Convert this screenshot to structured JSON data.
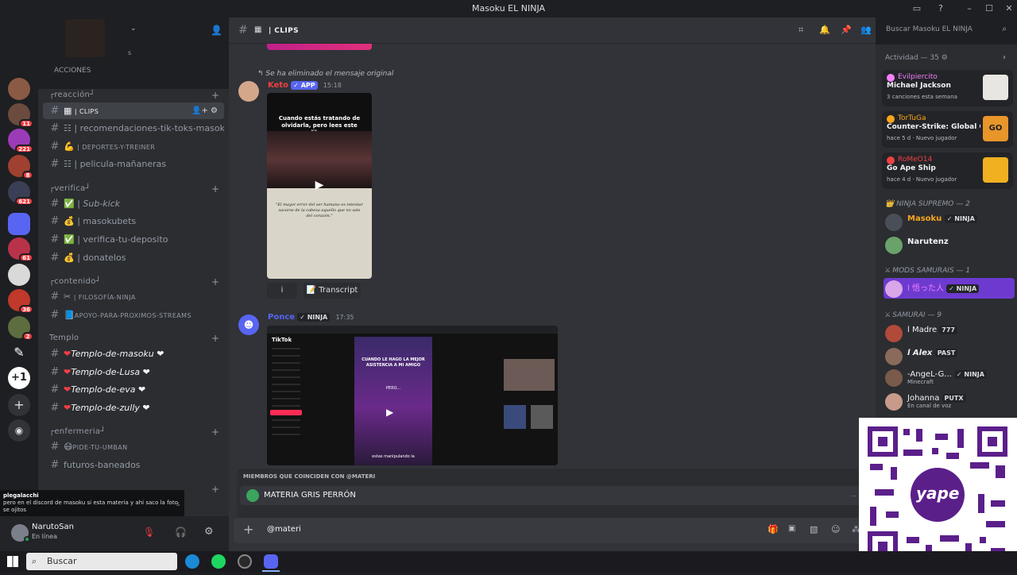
{
  "window": {
    "title": "Masoku EL NINJA",
    "minimize": "–",
    "maximize": "☐",
    "close": "✕"
  },
  "server": {
    "partial_name": "s",
    "partial_channel": "ACCIONES"
  },
  "guild_badges": [
    "11",
    "221",
    "8",
    "621",
    "61",
    "36",
    "2"
  ],
  "categories": [
    {
      "label": "┌reacción┘",
      "channels": [
        {
          "icon": "▦",
          "label": "| CLIPS",
          "active": true,
          "smallcaps": true
        },
        {
          "icon": "☷",
          "label": "| recomendaciones-tik-toks-masoku"
        },
        {
          "icon": "💪",
          "label": "| DEPORTES-Y-TREINER",
          "smallcaps": true
        },
        {
          "icon": "☷",
          "label": "| pelicula-mañaneras"
        }
      ]
    },
    {
      "label": "┌verifica┘",
      "channels": [
        {
          "icon": "✅",
          "label": "| Sub-kick",
          "italic": true
        },
        {
          "icon": "💰",
          "label": "| masokubets"
        },
        {
          "icon": "✅",
          "label": "| verifica-tu-deposito"
        },
        {
          "icon": "💰",
          "label": "| donatelos"
        }
      ]
    },
    {
      "label": "┌contenido┘",
      "channels": [
        {
          "icon": "✂",
          "label": "| FILOSOFÍA-NINJA",
          "smallcaps": true
        },
        {
          "icon": "📘",
          "label": "APOYO-PARA-PROXIMOS-STREAMS",
          "smallcaps": true
        }
      ]
    },
    {
      "label": "Templo",
      "channels": [
        {
          "icon": "❤",
          "label": "Templo-de-masoku ❤",
          "italic": true
        },
        {
          "icon": "❤",
          "label": "Templo-de-Lusa ❤",
          "italic": true
        },
        {
          "icon": "❤",
          "label": "Templo-de-eva ❤",
          "italic": true
        },
        {
          "icon": "❤",
          "label": "Templo-de-zully ❤",
          "italic": true
        }
      ]
    },
    {
      "label": "┌enfermeria┘",
      "channels": [
        {
          "icon": "😷",
          "label": "PIDE-TU-UMBAN",
          "smallcaps": true
        },
        {
          "icon": "",
          "label": "futuros-baneados"
        }
      ]
    }
  ],
  "notification": {
    "user": "plegalacchi",
    "text": "pero en el discord de masoku si esta materia y ahi saco la foto se ojitos",
    "tail": "s"
  },
  "user": {
    "name": "NarutoSan",
    "status": "En línea"
  },
  "channel_header": {
    "name": "| CLIPS",
    "search_placeholder": "Buscar Masoku EL NINJA"
  },
  "messages": [
    {
      "deleted_note": "Se ha eliminado el mensaje original",
      "author": "Keto",
      "tag": "✓ APP",
      "time": "15:18",
      "video_caption": "Cuando estás tratando de olvidarla, pero lees este libro:",
      "book_quote": "\"El mayor error del ser humano es intentar sacarse de la cabeza aquello que no sale del corazón.\"",
      "button_info": "i",
      "button_transcript": "Transcript"
    },
    {
      "author": "Ponce",
      "tag": "✓ NINJA",
      "time": "17:35",
      "tiktok_logo": "TikTok",
      "tiktok_caption": "CUANDO LE HAGO LA MEJOR ASISTENCIA A MI AMIGO",
      "tiktok_small": "PERO...",
      "tiktok_bottom": "estas manipulando la"
    }
  ],
  "mentions": {
    "header": "MIEMBROS QUE COINCIDEN CON @MATERI",
    "item": "MATERIA GRIS PERRÓN",
    "item_hint": "..."
  },
  "composer": {
    "value": "@materi"
  },
  "members_panel": {
    "activity_header": "Actividad — 35",
    "activities": [
      {
        "user": "Evilpiercito",
        "game": "Michael Jackson",
        "sub": "3 canciones esta semana",
        "color": "#f47fff"
      },
      {
        "user": "TorTuGa",
        "game": "Counter-Strike: Global Off...",
        "sub": "hace 5 d · Nuevo jugador",
        "color": "#faa61a"
      },
      {
        "user": "RoMeO14",
        "game": "Go Ape Ship",
        "sub": "hace 4 d · Nuevo jugador",
        "color": "#f23f43"
      }
    ],
    "groups": [
      {
        "label": "👑 NINJA SUPREMO — 2",
        "members": [
          {
            "name": "Masoku",
            "tag": "✓ NINJA",
            "color": "#faa61a"
          },
          {
            "name": "Narutenz",
            "tag": "",
            "color": "#f2f3f5"
          }
        ]
      },
      {
        "label": "⚔ MODS SAMURAIS — 1",
        "members": [
          {
            "name": "l 悟った人",
            "tag": "✓ NINJA",
            "color": "#f47fff"
          }
        ]
      },
      {
        "label": "⚔ SAMURAI — 9",
        "members": [
          {
            "name": "l Madre",
            "tag": "777",
            "color": "#f2f3f5"
          },
          {
            "name": "l Alex",
            "tag": "PAST",
            "color": "#f2f3f5"
          },
          {
            "name": "-AngeL-G...",
            "tag": "✓ NINJA",
            "color": "#f2f3f5",
            "status": "Minecraft"
          },
          {
            "name": "Johanna",
            "tag": "PUTX",
            "color": "#f2f3f5",
            "status": "En canal de voz"
          }
        ]
      }
    ]
  },
  "qr": {
    "label": "yape"
  },
  "taskbar": {
    "search": "Buscar"
  }
}
